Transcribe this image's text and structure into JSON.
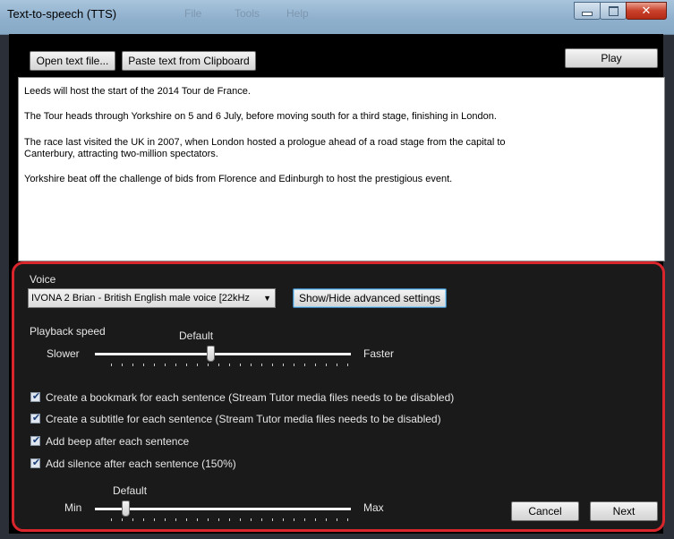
{
  "window": {
    "title": "Text-to-speech (TTS)",
    "ghost_menu": [
      "File",
      "Tools",
      "Help"
    ]
  },
  "toolbar": {
    "open_label": "Open text file...",
    "paste_label": "Paste text from Clipboard",
    "play_label": "Play"
  },
  "text": {
    "paragraphs": [
      "Leeds will host the start of the 2014 Tour de France.",
      "The Tour heads through Yorkshire on 5 and 6 July, before moving south for a third stage, finishing in London.",
      "The race last visited the UK in 2007, when London hosted a prologue ahead of a road stage from the capital to",
      "Canterbury, attracting two-million spectators.",
      "Yorkshire beat off the challenge of bids from Florence and Edinburgh to host the prestigious event."
    ]
  },
  "voice": {
    "label": "Voice",
    "selected": "IVONA 2 Brian - British English male voice [22kHz",
    "advanced_button": "Show/Hide advanced settings"
  },
  "playback": {
    "label": "Playback speed",
    "default_label": "Default",
    "min_label": "Slower",
    "max_label": "Faster",
    "level": 0.45
  },
  "options": [
    {
      "label": "Create a bookmark for each sentence (Stream Tutor media files needs to be disabled)",
      "checked": true
    },
    {
      "label": "Create a subtitle for each sentence (Stream Tutor media files needs to be disabled)",
      "checked": true
    },
    {
      "label": "Add beep after each sentence",
      "checked": true
    },
    {
      "label": "Add silence after each sentence (150%)",
      "checked": true
    }
  ],
  "silence": {
    "default_label": "Default",
    "min_label": "Min",
    "max_label": "Max",
    "level": 0.12
  },
  "footer": {
    "cancel_label": "Cancel",
    "next_label": "Next"
  },
  "colors": {
    "highlight_border": "#d9252c",
    "panel_bg": "#1a1a1a"
  }
}
